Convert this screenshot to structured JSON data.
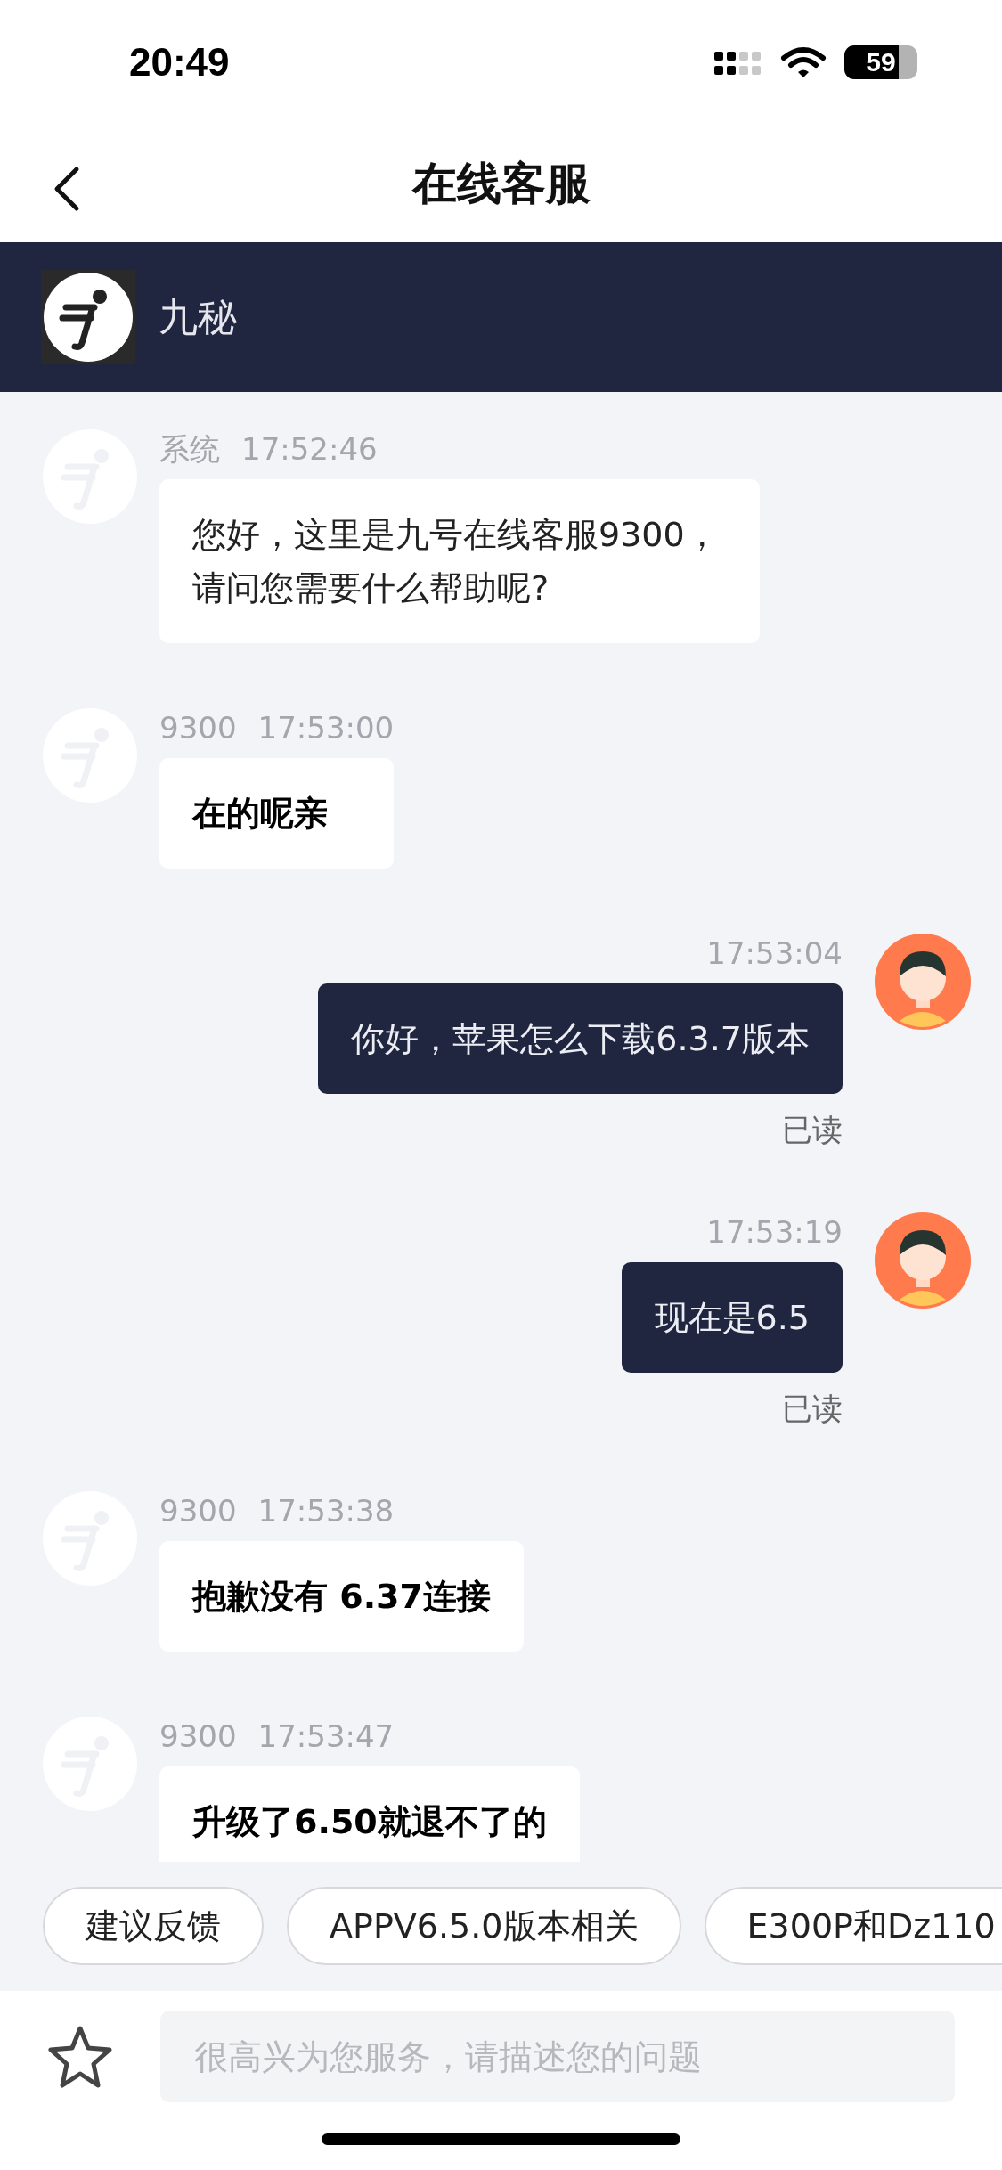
{
  "status_bar": {
    "time": "20:49",
    "battery": "59"
  },
  "nav": {
    "title": "在线客服"
  },
  "agent_header": {
    "name": "九秘"
  },
  "messages": [
    {
      "kind": "agent",
      "sender": "系统",
      "time": "17:52:46",
      "text": "您好，这里是九号在线客服9300，请问您需要什么帮助呢?",
      "bold": false
    },
    {
      "kind": "agent",
      "sender": "9300",
      "time": "17:53:00",
      "text": "在的呢亲",
      "bold": true
    },
    {
      "kind": "user",
      "time": "17:53:04",
      "text": "你好，苹果怎么下载6.3.7版本",
      "receipt": "已读"
    },
    {
      "kind": "user",
      "time": "17:53:19",
      "text": "现在是6.5",
      "receipt": "已读"
    },
    {
      "kind": "agent",
      "sender": "9300",
      "time": "17:53:38",
      "text": "抱歉没有 6.37连接",
      "bold": true
    },
    {
      "kind": "agent",
      "sender": "9300",
      "time": "17:53:47",
      "text": "升级了6.50就退不了的",
      "bold": true
    }
  ],
  "quick_replies": [
    "建议反馈",
    "APPV6.5.0版本相关",
    "E300P和Dz110"
  ],
  "composer": {
    "placeholder": "很高兴为您服务，请描述您的问题"
  }
}
